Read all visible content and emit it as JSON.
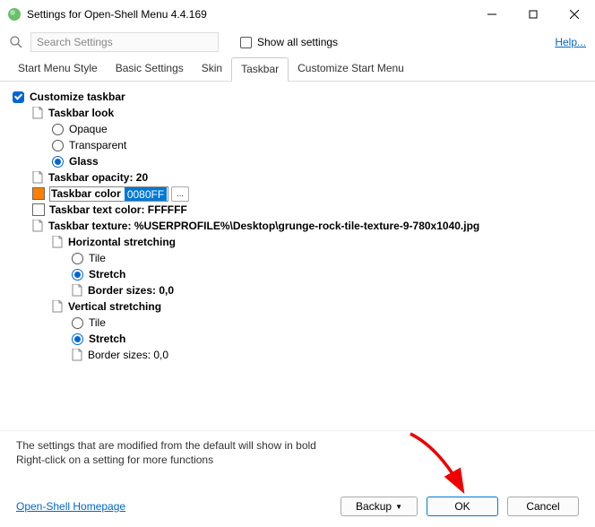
{
  "window": {
    "title": "Settings for Open-Shell Menu 4.4.169"
  },
  "toolbar": {
    "search_placeholder": "Search Settings",
    "show_all": "Show all settings",
    "help": "Help..."
  },
  "tabs": [
    {
      "label": "Start Menu Style",
      "active": false
    },
    {
      "label": "Basic Settings",
      "active": false
    },
    {
      "label": "Skin",
      "active": false
    },
    {
      "label": "Taskbar",
      "active": true
    },
    {
      "label": "Customize Start Menu",
      "active": false
    }
  ],
  "settings": {
    "customize": "Customize taskbar",
    "look": {
      "header": "Taskbar look",
      "opaque": "Opaque",
      "transparent": "Transparent",
      "glass": "Glass"
    },
    "opacity": "Taskbar opacity: 20",
    "color_label": "Taskbar color",
    "color_value": "0080FF",
    "color_swatch": "#FF8000",
    "browse": "...",
    "text_color": "Taskbar text color: FFFFFF",
    "text_swatch": "#FFFFFF",
    "texture": "Taskbar texture: %USERPROFILE%\\Desktop\\grunge-rock-tile-texture-9-780x1040.jpg",
    "hstretch": "Horizontal stretching",
    "vstretch": "Vertical stretching",
    "tile": "Tile",
    "stretch": "Stretch",
    "border": "Border sizes: 0,0"
  },
  "notes": {
    "line1": "The settings that are modified from the default will show in bold",
    "line2": "Right-click on a setting for more functions"
  },
  "buttons": {
    "backup": "Backup",
    "ok": "OK",
    "cancel": "Cancel"
  },
  "homepage": "Open-Shell Homepage"
}
